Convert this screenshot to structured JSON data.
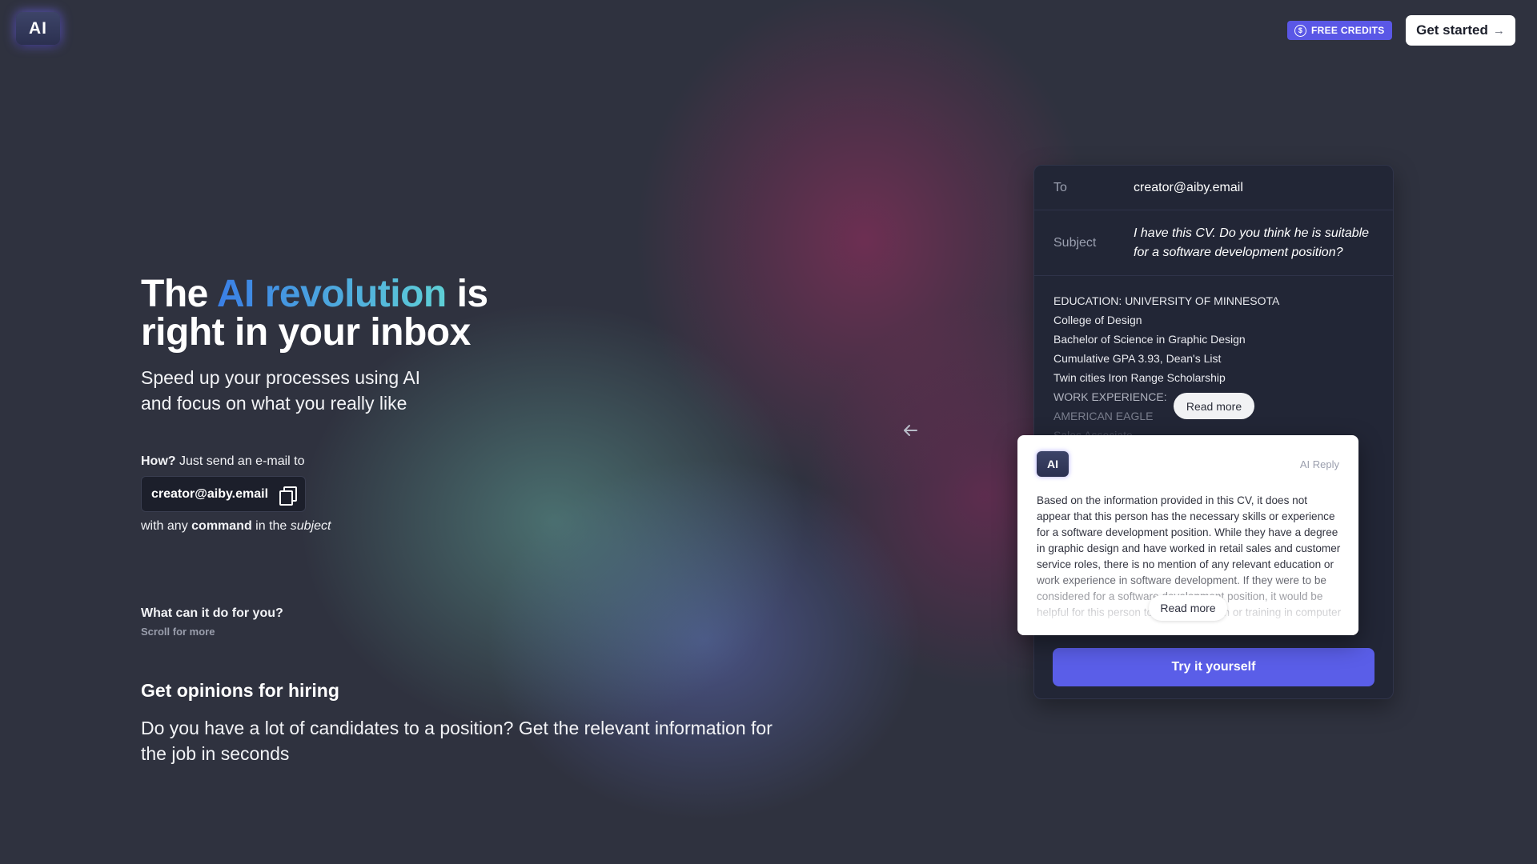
{
  "header": {
    "logo_text": "AI",
    "credits_label": "FREE CREDITS",
    "get_started_label": "Get started",
    "get_started_arrow": "→"
  },
  "hero": {
    "title_prefix": "The ",
    "title_highlight": "AI revolution",
    "title_suffix": " is",
    "title_line2": "right in your inbox",
    "subtitle_line1": "Speed up your processes using AI",
    "subtitle_line2": "and focus on what you really like",
    "how_bold": "How?",
    "how_text": " Just send an e-mail to",
    "email": "creator@aiby.email",
    "with_text": "with any ",
    "with_command": "command",
    "with_in": " in the ",
    "with_subject": "subject"
  },
  "features": {
    "heading": "What can it do for you?",
    "scroll_hint": "Scroll for more",
    "current_title": "Get opinions for hiring",
    "current_desc": "Do you have a lot of candidates to a position? Get the relevant information for the job in seconds"
  },
  "email_card": {
    "to_label": "To",
    "to_value": "creator@aiby.email",
    "subject_label": "Subject",
    "subject_value": "I have this CV. Do you think he is suitable for a software development position?",
    "cv_lines": [
      "EDUCATION: UNIVERSITY OF MINNESOTA",
      "College of Design",
      "Bachelor of Science in Graphic Design",
      "Cumulative GPA 3.93, Dean's List",
      "Twin cities Iron Range Scholarship",
      "WORK EXPERIENCE:",
      "AMERICAN EAGLE",
      "Sales Associate"
    ],
    "read_more_label": "Read more",
    "try_label": "Try it yourself"
  },
  "ai_reply": {
    "badge_text": "AI",
    "label": "AI Reply",
    "text": "Based on the information provided in this CV, it does not appear that this person has the necessary skills or experience for a software development position. While they have a degree in graphic design and have worked in retail sales and customer service roles, there is no mention of any relevant education or work experience in software development. If they were to be considered for a software development position, it would be helpful for this person to have education or training in computer",
    "read_more_label": "Read more"
  },
  "colors": {
    "accent": "#5a5ee8",
    "background": "#2f323f",
    "card": "#222636",
    "gradient_start": "#3a7fe6",
    "gradient_end": "#5fd0d6"
  },
  "icons": {
    "copy": "copy-icon",
    "back": "arrow-left-icon",
    "credits": "coin-icon"
  }
}
